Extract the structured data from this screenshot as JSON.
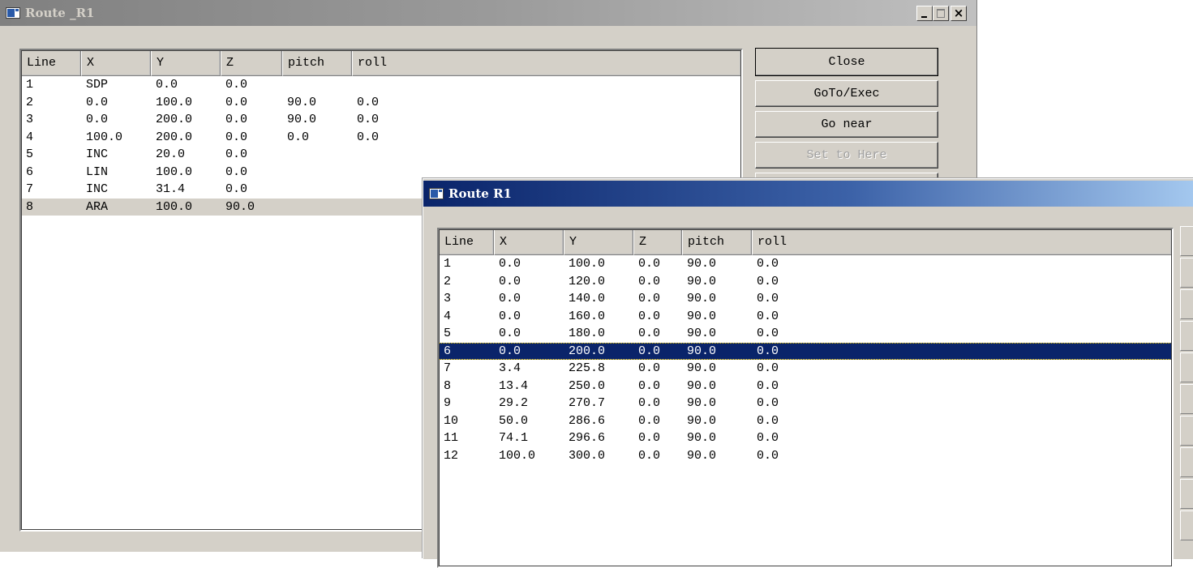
{
  "window_back": {
    "title": "Route _R1",
    "columns": [
      "Line",
      "X",
      "Y",
      "Z",
      "pitch",
      "roll"
    ],
    "rows": [
      [
        "1",
        "SDP",
        "0.0",
        "0.0",
        "",
        ""
      ],
      [
        "2",
        "0.0",
        "100.0",
        "0.0",
        "90.0",
        "0.0"
      ],
      [
        "3",
        "0.0",
        "200.0",
        "0.0",
        "90.0",
        "0.0"
      ],
      [
        "4",
        "100.0",
        "200.0",
        "0.0",
        "0.0",
        "0.0"
      ],
      [
        "5",
        "INC",
        "20.0",
        "0.0",
        "",
        ""
      ],
      [
        "6",
        "LIN",
        "100.0",
        "0.0",
        "",
        ""
      ],
      [
        "7",
        "INC",
        "31.4",
        "0.0",
        "",
        ""
      ],
      [
        "8",
        "ARA",
        "100.0",
        "90.0",
        "",
        ""
      ]
    ],
    "selected_row": 8,
    "buttons": {
      "close": "Close",
      "goto_exec": "GoTo/Exec",
      "go_near": "Go near",
      "set_to_here": "Set to Here"
    }
  },
  "window_front": {
    "title": "Route R1",
    "columns": [
      "Line",
      "X",
      "Y",
      "Z",
      "pitch",
      "roll"
    ],
    "rows": [
      [
        "1",
        "0.0",
        "100.0",
        "0.0",
        "90.0",
        "0.0"
      ],
      [
        "2",
        "0.0",
        "120.0",
        "0.0",
        "90.0",
        "0.0"
      ],
      [
        "3",
        "0.0",
        "140.0",
        "0.0",
        "90.0",
        "0.0"
      ],
      [
        "4",
        "0.0",
        "160.0",
        "0.0",
        "90.0",
        "0.0"
      ],
      [
        "5",
        "0.0",
        "180.0",
        "0.0",
        "90.0",
        "0.0"
      ],
      [
        "6",
        "0.0",
        "200.0",
        "0.0",
        "90.0",
        "0.0"
      ],
      [
        "7",
        "3.4",
        "225.8",
        "0.0",
        "90.0",
        "0.0"
      ],
      [
        "8",
        "13.4",
        "250.0",
        "0.0",
        "90.0",
        "0.0"
      ],
      [
        "9",
        "29.2",
        "270.7",
        "0.0",
        "90.0",
        "0.0"
      ],
      [
        "10",
        "50.0",
        "286.6",
        "0.0",
        "90.0",
        "0.0"
      ],
      [
        "11",
        "74.1",
        "296.6",
        "0.0",
        "90.0",
        "0.0"
      ],
      [
        "12",
        "100.0",
        "300.0",
        "0.0",
        "90.0",
        "0.0"
      ]
    ],
    "selected_row": 6
  },
  "colors": {
    "active_title": "#0a246a",
    "inactive_title": "#808080",
    "selection_active": "#0a246a",
    "selection_inactive": "#d4d0c8",
    "face": "#d4d0c8"
  }
}
